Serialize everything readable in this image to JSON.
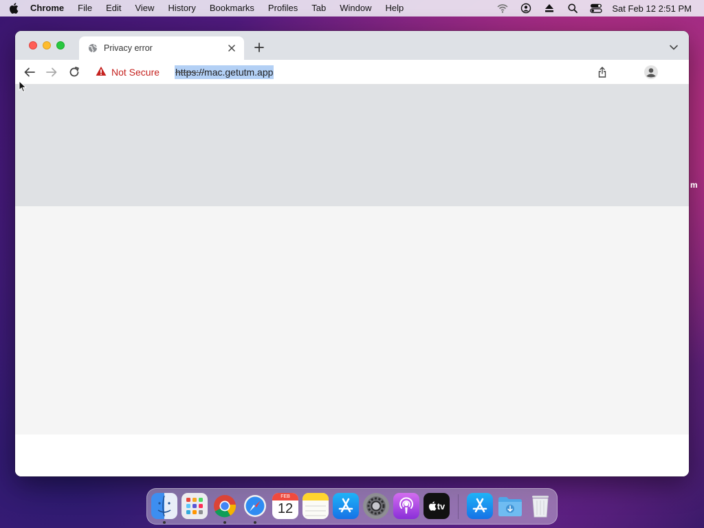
{
  "menubar": {
    "apple_icon": "apple-logo-icon",
    "app_name": "Chrome",
    "items": [
      "File",
      "Edit",
      "View",
      "History",
      "Bookmarks",
      "Profiles",
      "Tab",
      "Window",
      "Help"
    ],
    "status_icons": [
      "wifi-off-icon",
      "user-account-icon",
      "eject-icon",
      "spotlight-search-icon",
      "control-center-icon"
    ],
    "clock": "Sat Feb 12  2:51 PM"
  },
  "browser": {
    "tab": {
      "title": "Privacy error",
      "favicon": "globe-icon"
    },
    "toolbar": {
      "security_label": "Not Secure",
      "url_scheme": "https://",
      "url_host": "mac.getutm.app",
      "warning_color": "#c5221f"
    }
  },
  "peek_text": "m",
  "dock": {
    "apps": [
      "Finder",
      "Launchpad",
      "Google Chrome",
      "Safari",
      "Calendar",
      "Notes",
      "App Store",
      "System Preferences",
      "Podcasts",
      "Apple TV",
      "App Store",
      "Downloads",
      "Trash"
    ],
    "calendar": {
      "month": "FEB",
      "day": "12"
    },
    "tv_label": "tv"
  }
}
